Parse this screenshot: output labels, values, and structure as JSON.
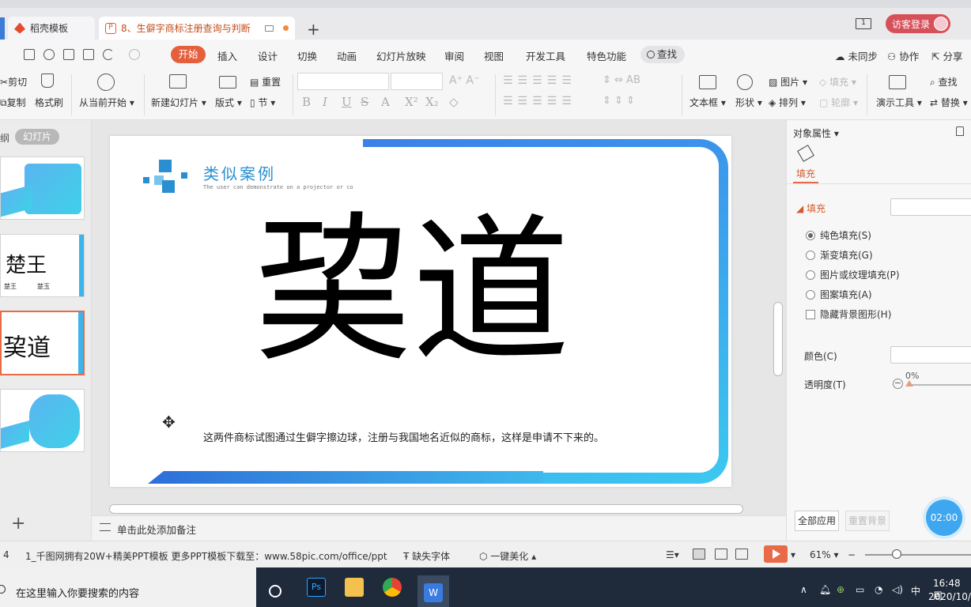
{
  "tabs": {
    "tab1_label": "稻壳模板",
    "tab2_label": "8、生僻字商标注册查询与判断",
    "new_tab": "+"
  },
  "window": {
    "page_badge": "1",
    "visitor_login": "访客登录"
  },
  "menu": {
    "active": "开始",
    "items": [
      "插入",
      "设计",
      "切换",
      "动画",
      "幻灯片放映",
      "审阅",
      "视图",
      "开发工具",
      "特色功能"
    ],
    "find": "查找",
    "right": [
      "未同步",
      "协作",
      "分享"
    ]
  },
  "ribbon": {
    "cut": "剪切",
    "copy": "复制",
    "format_painter": "格式刷",
    "from_current": "从当前开始",
    "new_slide": "新建幻灯片",
    "layout": "版式",
    "reset": "重置",
    "section": "节",
    "textbox": "文本框",
    "shape": "形状",
    "picture": "图片",
    "arrange": "排列",
    "fill": "填充",
    "outline": "轮廓",
    "presentation_tools": "演示工具",
    "find": "查找",
    "replace": "替换"
  },
  "left_panel": {
    "tab_outline": "纲",
    "tab_slides": "幻灯片",
    "thumb2_big": "楚王",
    "thumb2_small_a": "楚王",
    "thumb2_small_b": "楚玉",
    "thumb3_big": "巭道",
    "add": "+"
  },
  "slide": {
    "title": "类似案例",
    "subtitle": "The user can demonstrate on a projector or co",
    "big_text": "巭道",
    "note": "这两件商标试图通过生僻字擦边球，注册与我国地名近似的商标，这样是申请不下来的。"
  },
  "notes_placeholder": "单击此处添加备注",
  "right_panel": {
    "title": "对象属性",
    "tab_fill": "填充",
    "section_fill": "填充",
    "opt_solid": "纯色填充(S)",
    "opt_gradient": "渐变填充(G)",
    "opt_picture": "图片或纹理填充(P)",
    "opt_pattern": "图案填充(A)",
    "opt_hide_bg": "隐藏背景图形(H)",
    "color": "颜色(C)",
    "transparency": "透明度(T)",
    "transparency_value": "0%",
    "apply_all": "全部应用",
    "reset_bg": "重置背景",
    "timer": "02:00"
  },
  "statusbar": {
    "slide_no": "4",
    "theme": "1_千图网拥有20W+精美PPT模板 更多PPT模板下载至：www.58pic.com/office/ppt",
    "missing_font": "缺失字体",
    "beautify": "一键美化",
    "zoom": "61%"
  },
  "taskbar": {
    "search_placeholder": "在这里输入你要搜索的内容",
    "ime": "中",
    "time": "16:48 周",
    "date": "2020/10/"
  },
  "colors": {
    "accent_orange": "#e55f3c",
    "slide_blue": "#3c80e8",
    "slide_cyan": "#3cc8f0",
    "title_blue": "#2a8fd0",
    "timer_blue": "#3ea7f0"
  }
}
